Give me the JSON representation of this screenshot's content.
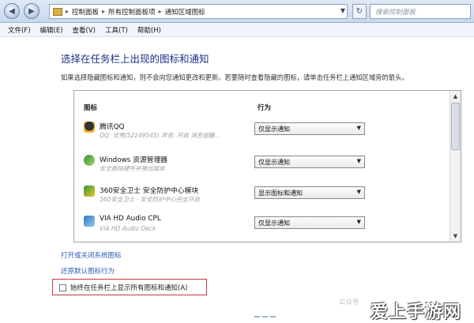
{
  "window": {
    "breadcrumbs": [
      "控制面板",
      "所有控制面板项",
      "通知区域图标"
    ],
    "search_placeholder": "搜索控制面板"
  },
  "menu": [
    "文件(F)",
    "编辑(E)",
    "查看(V)",
    "工具(T)",
    "帮助(H)"
  ],
  "page": {
    "title": "选择在任务栏上出现的图标和通知",
    "description": "如果选择隐藏图标和通知，则不会向您通知更改和更新。若要随时查看隐藏的图标，请单击任务栏上通知区域旁的箭头。"
  },
  "table": {
    "headers": {
      "icon": "图标",
      "behavior": "行为"
    },
    "rows": [
      {
        "name": "腾讯QQ",
        "desc": "QQ: 优秀(52249545)  声音: 开启  消息提醒...",
        "behavior": "仅显示通知",
        "icon": "qq-penguin-icon"
      },
      {
        "name": "Windows 资源管理器",
        "desc": "安全删除硬件并弹出媒体",
        "behavior": "仅显示通知",
        "icon": "windows-explorer-icon"
      },
      {
        "name": "360安全卫士 安全防护中心模块",
        "desc": "360安全卫士 - 安全防护中心完全开启",
        "behavior": "显示图标和通知",
        "icon": "360-security-icon"
      },
      {
        "name": "VIA HD Audio CPL",
        "desc": "VIA HD Audio Deck",
        "behavior": "仅显示通知",
        "icon": "via-audio-icon"
      }
    ]
  },
  "links": {
    "system_icons": "打开或关闭系统图标",
    "restore_default": "还原默认图标行为"
  },
  "checkbox": {
    "label": "始终在任务栏上显示所有图标和通知(A)",
    "checked": false
  },
  "watermark": {
    "text": "公众号",
    "brand": "爱上手游网"
  }
}
